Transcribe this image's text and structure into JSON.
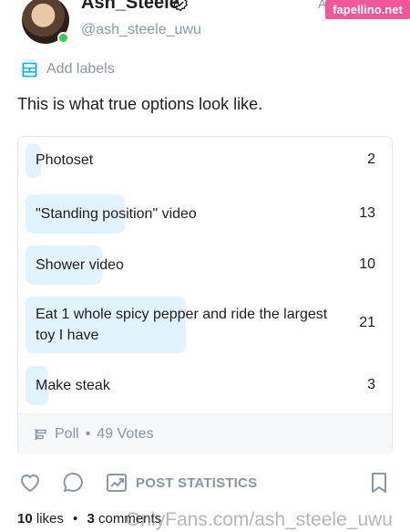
{
  "creator": {
    "display_name": "Ash_Steele",
    "handle": "@ash_steele_uwu",
    "more_glyph": "A"
  },
  "watermark_badge": "fapellino.net",
  "add_labels": "Add labels",
  "post_text": "This is what true options look like.",
  "poll": {
    "options": [
      {
        "label": "Photoset",
        "votes": "2",
        "fraction": 0.041
      },
      {
        "label": "\"Standing position\" video",
        "votes": "13",
        "fraction": 0.265
      },
      {
        "label": "Shower video",
        "votes": "10",
        "fraction": 0.204
      },
      {
        "label": "Eat 1 whole spicy pepper and ride the largest toy I have",
        "votes": "21",
        "fraction": 0.429
      },
      {
        "label": "Make steak",
        "votes": "3",
        "fraction": 0.061
      }
    ],
    "type_label": "Poll",
    "separator": "•",
    "total_votes": "49 Votes"
  },
  "actions": {
    "like_icon": "heart-icon",
    "comment_icon": "comment-icon",
    "stats_icon": "chart-icon",
    "stats_label": "POST STATISTICS",
    "bookmark_icon": "bookmark-icon"
  },
  "footer": {
    "likes_count": "10",
    "likes_word": "likes",
    "separator": "•",
    "comments_count": "3",
    "comments_word": "comments"
  },
  "url_watermark": "OnlyFans.com/ash_steele_uwu",
  "colors": {
    "accent": "#00aff0",
    "muted": "#8a96a3",
    "poll_fill": "#e3f3fd",
    "online": "#3fc55a",
    "badge": "#f0569a"
  }
}
